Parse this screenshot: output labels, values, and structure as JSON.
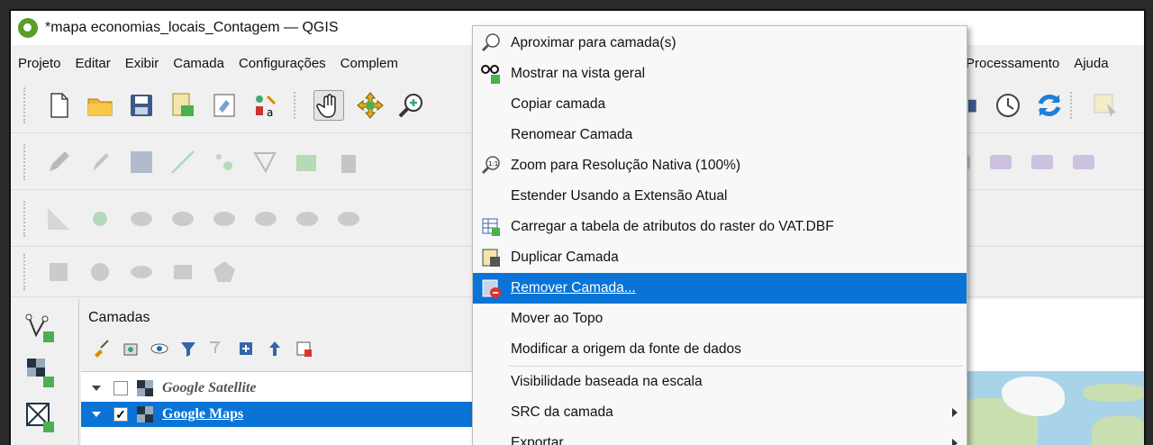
{
  "window": {
    "title": "*mapa economias_locais_Contagem — QGIS"
  },
  "menubar": {
    "items": [
      "Projeto",
      "Editar",
      "Exibir",
      "Camada",
      "Configurações",
      "Complem"
    ],
    "right_items": [
      "Processamento",
      "Ajuda"
    ]
  },
  "layers_panel": {
    "title": "Camadas",
    "layers": [
      {
        "name": "Google Satellite",
        "checked": false,
        "selected": false
      },
      {
        "name": "Google Maps",
        "checked": true,
        "selected": true
      }
    ],
    "checkmark": "✓"
  },
  "context_menu": {
    "items": [
      {
        "label": "Aproximar para camada(s)",
        "icon": "zoom-to-layer-icon"
      },
      {
        "label": "Mostrar na vista geral",
        "icon": "overview-icon"
      },
      {
        "label": "Copiar camada"
      },
      {
        "label": "Renomear Camada"
      },
      {
        "label": "Zoom para Resolução Nativa (100%)",
        "icon": "zoom-native-icon"
      },
      {
        "label": "Estender Usando a Extensão Atual"
      },
      {
        "label": "Carregar a tabela de atributos do raster do VAT.DBF",
        "icon": "attribute-table-icon"
      },
      {
        "label": "Duplicar Camada",
        "icon": "duplicate-layer-icon"
      },
      {
        "label": "Remover Camada...",
        "icon": "remove-layer-icon",
        "highlighted": true
      },
      {
        "label": "Mover ao Topo"
      },
      {
        "label": "Modificar a origem da fonte de dados"
      },
      {
        "label": "Visibilidade baseada na escala"
      },
      {
        "label": "SRC da camada",
        "submenu": true
      },
      {
        "label": "Exportar",
        "submenu": true
      }
    ]
  },
  "colors": {
    "selection": "#0a73d6",
    "qgis_green": "#5a9d2a"
  }
}
